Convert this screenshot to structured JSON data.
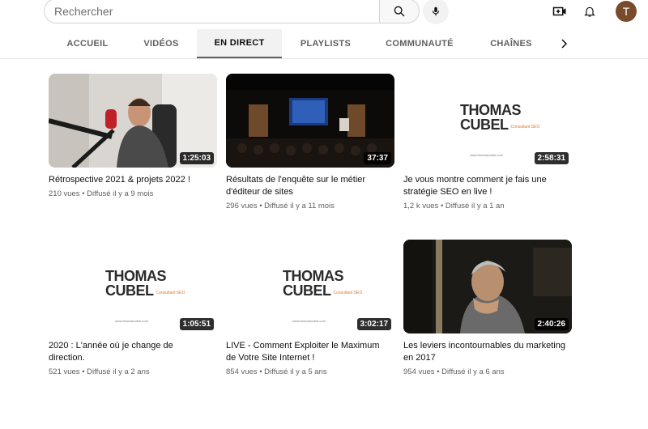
{
  "search": {
    "placeholder": "Rechercher"
  },
  "header": {
    "avatar_letter": "T"
  },
  "tabs": [
    {
      "label": "ACCUEIL"
    },
    {
      "label": "VIDÉOS"
    },
    {
      "label": "EN DIRECT"
    },
    {
      "label": "PLAYLISTS"
    },
    {
      "label": "COMMUNAUTÉ"
    },
    {
      "label": "CHAÎNES"
    }
  ],
  "logo": {
    "line1": "THOMAS",
    "line2": "CUBEL",
    "tagline": "Consultant SEO",
    "url": "www.thomascubel.com"
  },
  "videos": [
    {
      "title": "Rétrospective 2021 & projets 2022 !",
      "views": "210 vues",
      "when": "Diffusé il y a 9 mois",
      "duration": "1:25:03"
    },
    {
      "title": "Résultats de l'enquête sur le métier d'éditeur de sites",
      "views": "296 vues",
      "when": "Diffusé il y a 11 mois",
      "duration": "37:37"
    },
    {
      "title": "Je vous montre comment je fais une stratégie SEO en live !",
      "views": "1,2 k vues",
      "when": "Diffusé il y a 1 an",
      "duration": "2:58:31"
    },
    {
      "title": "2020 : L'année où je change de direction.",
      "views": "521 vues",
      "when": "Diffusé il y a 2 ans",
      "duration": "1:05:51"
    },
    {
      "title": "LIVE - Comment Exploiter le Maximum de Votre Site Internet !",
      "views": "854 vues",
      "when": "Diffusé il y a 5 ans",
      "duration": "3:02:17"
    },
    {
      "title": "Les leviers incontournables du marketing en 2017",
      "views": "954 vues",
      "when": "Diffusé il y a 6 ans",
      "duration": "2:40:26"
    }
  ]
}
